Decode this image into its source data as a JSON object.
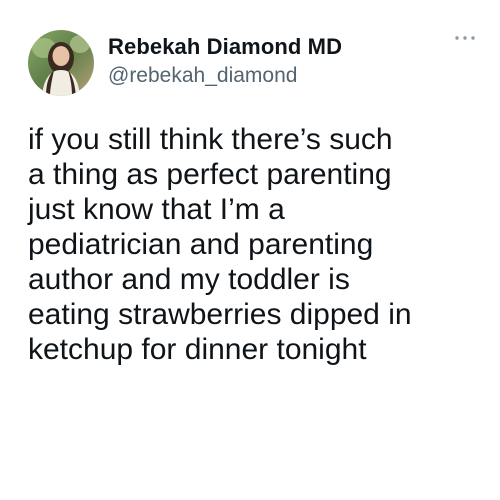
{
  "tweet": {
    "author": {
      "display_name": "Rebekah Diamond MD",
      "handle": "@rebekah_diamond",
      "avatar": "profile-photo"
    },
    "more_icon": "ellipsis-icon",
    "text": "if you still think there’s such\na thing as perfect parenting\njust know that I’m a\npediatrician and parenting\nauthor and my toddler is\neating strawberries dipped in\nketchup for dinner tonight"
  }
}
